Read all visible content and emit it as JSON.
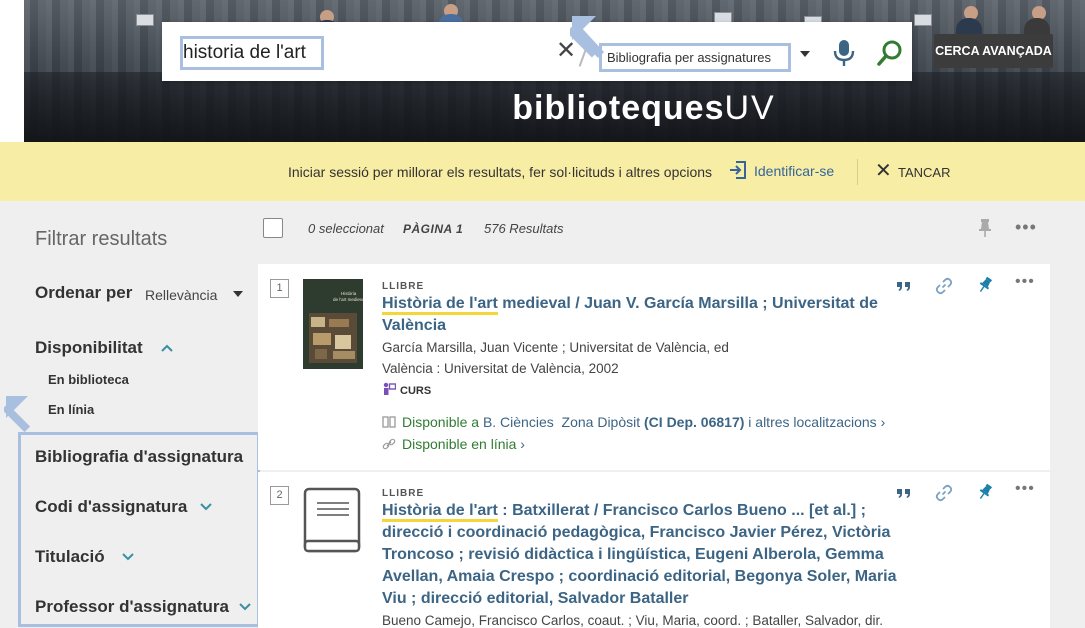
{
  "search": {
    "query": "historia de l'art",
    "scope": "Bibliografia per assignatures",
    "clear_icon": "close-icon",
    "mic_icon": "microphone-icon",
    "go_icon": "search-icon",
    "advanced_label": "CERCA AVANÇADA"
  },
  "brand": {
    "main": "biblioteques",
    "suffix": "UV"
  },
  "banner": {
    "text": "Iniciar sessió per millorar els resultats, fer sol·licituds i altres opcions",
    "login_label": "Identificar-se",
    "close_label": "TANCAR"
  },
  "filters": {
    "title": "Filtrar resultats",
    "sort_label": "Ordenar per",
    "sort_value": "Rellevància",
    "facets": [
      {
        "label": "Disponibilitat",
        "items": [
          "En biblioteca",
          "En línia"
        ]
      },
      {
        "label": "Bibliografia d'assignatura"
      },
      {
        "label": "Codi d'assignatura"
      },
      {
        "label": "Titulació"
      },
      {
        "label": "Professor d'assignatura"
      }
    ]
  },
  "toolbar": {
    "selected": "0 seleccionat",
    "page": "PÀGINA 1",
    "count": "576 Resultats"
  },
  "results": [
    {
      "num": "1",
      "type": "LLIBRE",
      "title_hl": "Història de l'art",
      "title_rest": " medieval / Juan V. García Marsilla ; Universitat de València",
      "line1": "García Marsilla, Juan Vicente ; Universitat de València, ed",
      "line2": "València : Universitat de València, 2002",
      "course_tag": "CURS",
      "avail_prefix": "Disponible a ",
      "avail_library": "B. Ciències",
      "avail_zone": "Zona Dipòsit",
      "avail_call": "(CI Dep. 06817)",
      "avail_more": "i altres localitzacions",
      "online": "Disponible en línia",
      "cover_title": "Història de l'art medieval"
    },
    {
      "num": "2",
      "type": "LLIBRE",
      "title_hl": "Història de l'art",
      "title_rest": " : Batxillerat / Francisco Carlos Bueno ... [et al.] ; direcció i coordinació pedagògica, Francisco Javier Pérez, Victòria Troncoso ; revisió didàctica i lingüística, Eugeni Alberola, Gemma Avellan, Amaia Crespo ; coordinació editorial, Begonya Soler, Maria Viu ; direcció editorial, Salvador Bataller",
      "line1": "Bueno Camejo, Francisco Carlos, coaut. ; Viu, Maria, coord. ; Bataller, Salvador, dir."
    }
  ],
  "colors": {
    "banner_bg": "#f7eda4",
    "link_blue": "#3c6585",
    "available_green": "#317c32",
    "highlight_yellow": "#f2d63c",
    "annotation_blue": "#a9bfdf"
  }
}
